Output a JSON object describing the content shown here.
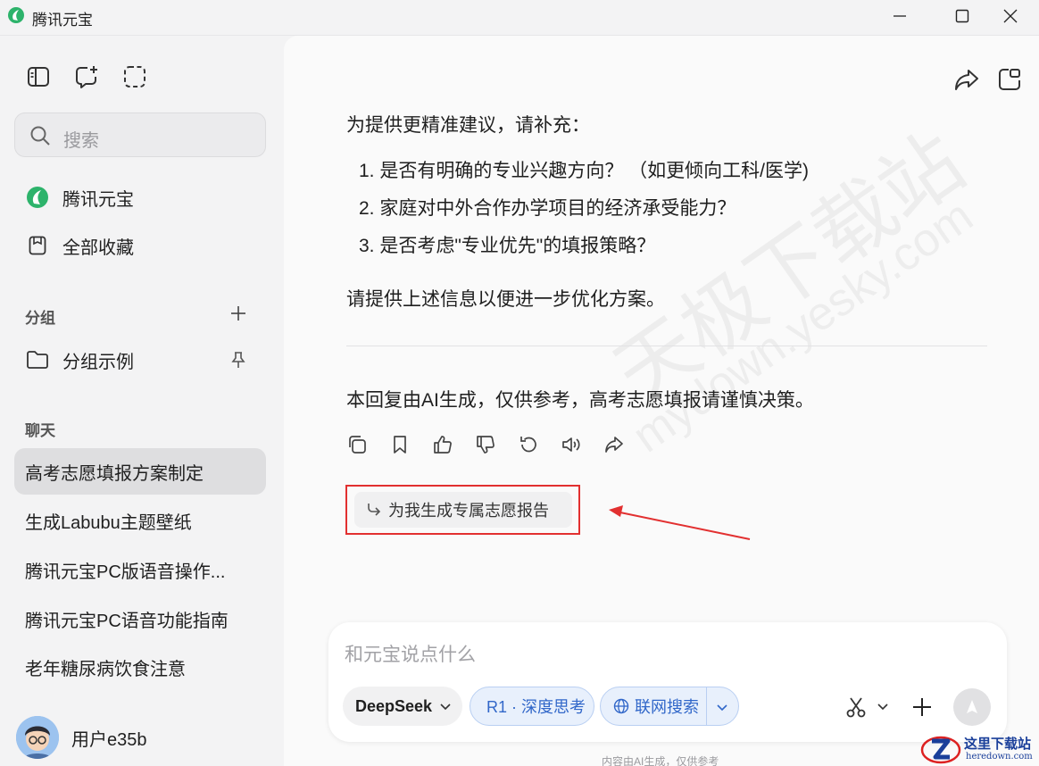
{
  "window": {
    "title": "腾讯元宝"
  },
  "sidebar": {
    "search_placeholder": "搜索",
    "nav": [
      {
        "label": "腾讯元宝",
        "icon": "yuanbao-logo-icon"
      },
      {
        "label": "全部收藏",
        "icon": "bookmark-icon"
      }
    ],
    "groups_title": "分组",
    "group_items": [
      {
        "label": "分组示例"
      }
    ],
    "chats_title": "聊天",
    "chats": [
      {
        "label": "高考志愿填报方案制定",
        "active": true
      },
      {
        "label": "生成Labubu主题壁纸"
      },
      {
        "label": "腾讯元宝PC版语音操作..."
      },
      {
        "label": "腾讯元宝PC语音功能指南"
      },
      {
        "label": "老年糖尿病饮食注意"
      }
    ],
    "user": {
      "name": "用户e35b"
    }
  },
  "conversation": {
    "intro": "为提供更精准建议，请补充：",
    "questions": [
      "1. 是否有明确的专业兴趣方向？ （如更倾向工科/医学)",
      "2. 家庭对中外合作办学项目的经济承受能力？",
      "3. 是否考虑\"专业优先\"的填报策略？"
    ],
    "closing": "请提供上述信息以便进一步优化方案。",
    "disclaimer": "本回复由AI生成，仅供参考，高考志愿填报请谨慎决策。",
    "suggestion": "为我生成专属志愿报告",
    "watermark_main": "天极下载站",
    "watermark_url": "mydown.yesky.com"
  },
  "composer": {
    "placeholder": "和元宝说点什么",
    "model": "DeepSeek",
    "think_label": "R1 · 深度思考",
    "web_label": "联网搜索",
    "footnote": "内容由AI生成，仅供参考"
  },
  "site_logo": {
    "line1": "这里下载站",
    "line2": "heredown.com"
  },
  "colors": {
    "accent_blue": "#3167c9",
    "highlight_red": "#e23030",
    "brand_green": "#2db36b"
  }
}
